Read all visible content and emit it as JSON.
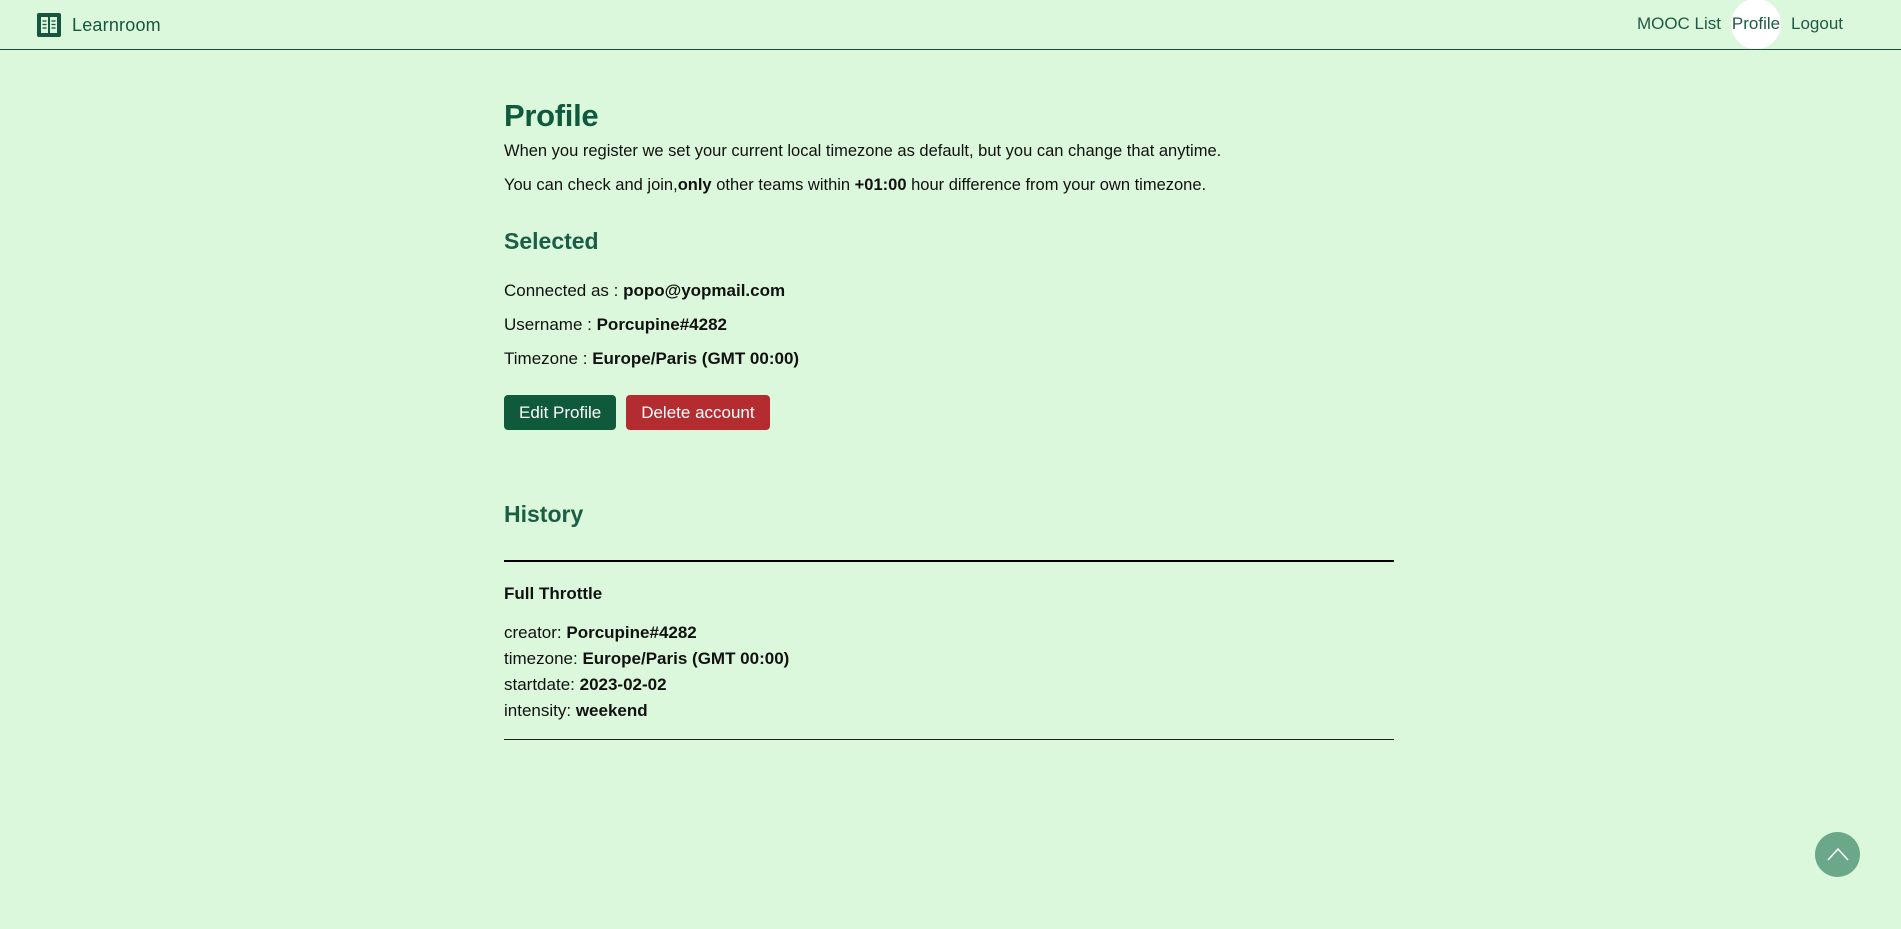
{
  "navbar": {
    "brand": "Learnroom",
    "links": [
      {
        "label": "MOOC List"
      },
      {
        "label": "Profile",
        "active": true
      },
      {
        "label": "Logout"
      }
    ]
  },
  "profile": {
    "title": "Profile",
    "intro_line": "When you register we set your current local timezone as default, but you can change that anytime.",
    "join_prefix": "You can check and join,",
    "join_only": "only",
    "join_middle": " other teams within ",
    "join_offset": "+01:00",
    "join_suffix": " hour difference from your own timezone."
  },
  "selected": {
    "title": "Selected",
    "connected_label": "Connected as : ",
    "connected_value": "popo@yopmail.com",
    "username_label": "Username : ",
    "username_value": "Porcupine#4282",
    "timezone_label": "Timezone : ",
    "timezone_value": "Europe/Paris (GMT 00:00)",
    "edit_button": "Edit Profile",
    "delete_button": "Delete account"
  },
  "history": {
    "title": "History",
    "items": [
      {
        "name": "Full Throttle",
        "creator_label": "creator: ",
        "creator": "Porcupine#4282",
        "timezone_label": "timezone: ",
        "timezone": "Europe/Paris (GMT 00:00)",
        "startdate_label": "startdate: ",
        "startdate": "2023-02-02",
        "intensity_label": "intensity: ",
        "intensity": "weekend"
      }
    ]
  },
  "colors": {
    "background": "#dcf8dc",
    "brand_green": "#0e5a3b",
    "danger_red": "#b42c30",
    "scroll_button": "#6ba88a"
  },
  "icons": {
    "brand": "book-icon",
    "scroll_top": "chevron-up-icon"
  }
}
